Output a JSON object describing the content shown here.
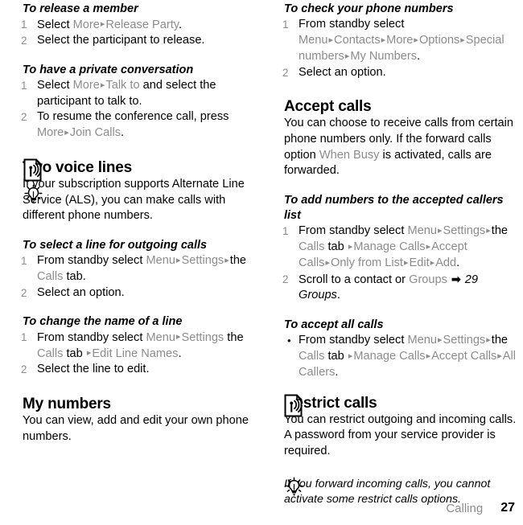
{
  "document": {
    "footer": {
      "section_label": "Calling",
      "page_number": "27"
    },
    "colors": {
      "body_text": "#000000",
      "menu_item_gray": "#8c8c8c",
      "step_number_gray": "#8c8c8c"
    }
  },
  "left_column": {
    "proc_release_member": {
      "heading": "To release a member",
      "steps": [
        {
          "number": "1",
          "parts": [
            {
              "t": "Select ",
              "s": "plain"
            },
            {
              "t": "More",
              "s": "menu"
            },
            {
              "t": "▸",
              "s": "arrow"
            },
            {
              "t": "Release Party",
              "s": "menu"
            },
            {
              "t": ".",
              "s": "plain"
            }
          ]
        },
        {
          "number": "2",
          "parts": [
            {
              "t": "Select the participant to release.",
              "s": "plain"
            }
          ]
        }
      ]
    },
    "proc_private_conversation": {
      "heading": "To have a private conversation",
      "steps": [
        {
          "number": "1",
          "parts": [
            {
              "t": "Select ",
              "s": "plain"
            },
            {
              "t": "More",
              "s": "menu"
            },
            {
              "t": "▸",
              "s": "arrow"
            },
            {
              "t": "Talk to",
              "s": "menu"
            },
            {
              "t": " and select the participant to talk to.",
              "s": "plain"
            }
          ]
        },
        {
          "number": "2",
          "parts": [
            {
              "t": "To resume the conference call, press ",
              "s": "plain"
            },
            {
              "t": "More",
              "s": "menu"
            },
            {
              "t": "▸",
              "s": "arrow"
            },
            {
              "t": "Join Calls",
              "s": "menu"
            },
            {
              "t": ".",
              "s": "plain"
            }
          ]
        }
      ]
    },
    "section_two_voice_lines": {
      "icon": "network-operator-document-icon",
      "heading": "Two voice lines",
      "tip_icon": "lightbulb-tip-icon",
      "body": "If your subscription supports Alternate Line Service (ALS), you can make calls with different phone numbers."
    },
    "proc_select_line": {
      "heading": "To select a line for outgoing calls",
      "steps": [
        {
          "number": "1",
          "parts": [
            {
              "t": "From standby select ",
              "s": "plain"
            },
            {
              "t": "Menu",
              "s": "menu"
            },
            {
              "t": "▸",
              "s": "arrow"
            },
            {
              "t": "Settings",
              "s": "menu"
            },
            {
              "t": "▸",
              "s": "arrow"
            },
            {
              "t": "the ",
              "s": "plain"
            },
            {
              "t": "Calls",
              "s": "menu"
            },
            {
              "t": " tab.",
              "s": "plain"
            }
          ]
        },
        {
          "number": "2",
          "parts": [
            {
              "t": "Select an option.",
              "s": "plain"
            }
          ]
        }
      ]
    },
    "proc_change_line_name": {
      "heading": "To change the name of a line",
      "steps": [
        {
          "number": "1",
          "parts": [
            {
              "t": "From standby select ",
              "s": "plain"
            },
            {
              "t": "Menu",
              "s": "menu"
            },
            {
              "t": "▸",
              "s": "arrow"
            },
            {
              "t": "Settings",
              "s": "menu"
            },
            {
              "t": " the ",
              "s": "plain"
            },
            {
              "t": "Calls",
              "s": "menu"
            },
            {
              "t": " tab ",
              "s": "plain"
            },
            {
              "t": "▸",
              "s": "arrow"
            },
            {
              "t": "Edit Line Names",
              "s": "menu"
            },
            {
              "t": ".",
              "s": "plain"
            }
          ]
        },
        {
          "number": "2",
          "parts": [
            {
              "t": "Select the line to edit.",
              "s": "plain"
            }
          ]
        }
      ]
    },
    "section_my_numbers": {
      "heading": "My numbers",
      "body": "You can view, add and edit your own phone numbers."
    }
  },
  "right_column": {
    "proc_check_numbers": {
      "heading": "To check your phone numbers",
      "steps": [
        {
          "number": "1",
          "parts": [
            {
              "t": "From standby select ",
              "s": "plain"
            },
            {
              "t": "Menu",
              "s": "menu"
            },
            {
              "t": "▸",
              "s": "arrow"
            },
            {
              "t": "Contacts",
              "s": "menu"
            },
            {
              "t": "▸",
              "s": "arrow"
            },
            {
              "t": "More",
              "s": "menu"
            },
            {
              "t": "▸",
              "s": "arrow"
            },
            {
              "t": "Options",
              "s": "menu"
            },
            {
              "t": "▸",
              "s": "arrow"
            },
            {
              "t": "Special numbers",
              "s": "menu"
            },
            {
              "t": "▸",
              "s": "arrow"
            },
            {
              "t": "My Numbers",
              "s": "menu"
            },
            {
              "t": ".",
              "s": "plain"
            }
          ]
        },
        {
          "number": "2",
          "parts": [
            {
              "t": "Select an option.",
              "s": "plain"
            }
          ]
        }
      ]
    },
    "section_accept_calls": {
      "heading": "Accept calls",
      "body_parts": [
        {
          "t": "You can choose to receive calls from certain phone numbers only. If the forward calls option ",
          "s": "plain"
        },
        {
          "t": "When Busy",
          "s": "menu"
        },
        {
          "t": " is activated, calls are forwarded.",
          "s": "plain"
        }
      ]
    },
    "proc_add_accepted": {
      "heading": "To add numbers to the accepted callers list",
      "steps": [
        {
          "number": "1",
          "parts": [
            {
              "t": "From standby select ",
              "s": "plain"
            },
            {
              "t": "Menu",
              "s": "menu"
            },
            {
              "t": "▸",
              "s": "arrow"
            },
            {
              "t": "Settings",
              "s": "menu"
            },
            {
              "t": "▸",
              "s": "arrow"
            },
            {
              "t": "the ",
              "s": "plain"
            },
            {
              "t": "Calls",
              "s": "menu"
            },
            {
              "t": " tab ",
              "s": "plain"
            },
            {
              "t": "▸",
              "s": "arrow"
            },
            {
              "t": "Manage Calls",
              "s": "menu"
            },
            {
              "t": "▸",
              "s": "arrow"
            },
            {
              "t": "Accept Calls",
              "s": "menu"
            },
            {
              "t": "▸",
              "s": "arrow"
            },
            {
              "t": "Only from List",
              "s": "menu"
            },
            {
              "t": "▸",
              "s": "arrow"
            },
            {
              "t": "Edit",
              "s": "menu"
            },
            {
              "t": "▸",
              "s": "arrow"
            },
            {
              "t": "Add",
              "s": "menu"
            },
            {
              "t": ".",
              "s": "plain"
            }
          ]
        },
        {
          "number": "2",
          "parts": [
            {
              "t": "Scroll to a contact or ",
              "s": "plain"
            },
            {
              "t": "Groups",
              "s": "menu"
            },
            {
              "t": " ",
              "s": "plain"
            },
            {
              "t": "➡",
              "s": "xrefarrow"
            },
            {
              "t": " 29 Groups",
              "s": "xref"
            },
            {
              "t": ".",
              "s": "plain"
            }
          ]
        }
      ]
    },
    "proc_accept_all": {
      "heading": "To accept all calls",
      "bullet": "•",
      "steps": [
        {
          "parts": [
            {
              "t": "From standby select ",
              "s": "plain"
            },
            {
              "t": "Menu",
              "s": "menu"
            },
            {
              "t": "▸",
              "s": "arrow"
            },
            {
              "t": "Settings",
              "s": "menu"
            },
            {
              "t": "▸",
              "s": "arrow"
            },
            {
              "t": "the ",
              "s": "plain"
            },
            {
              "t": "Calls",
              "s": "menu"
            },
            {
              "t": " tab ",
              "s": "plain"
            },
            {
              "t": "▸",
              "s": "arrow"
            },
            {
              "t": "Manage Calls",
              "s": "menu"
            },
            {
              "t": "▸",
              "s": "arrow"
            },
            {
              "t": "Accept Calls",
              "s": "menu"
            },
            {
              "t": "▸",
              "s": "arrow"
            },
            {
              "t": "All Callers",
              "s": "menu"
            },
            {
              "t": ".",
              "s": "plain"
            }
          ]
        }
      ]
    },
    "section_restrict_calls": {
      "icon": "network-operator-document-icon",
      "heading": "Restrict calls",
      "body": "You can restrict outgoing and incoming calls. A password from your service provider is required."
    },
    "tip_note": {
      "icon": "lightbulb-tip-icon",
      "text": "If you forward incoming calls, you cannot activate some restrict calls options."
    }
  }
}
